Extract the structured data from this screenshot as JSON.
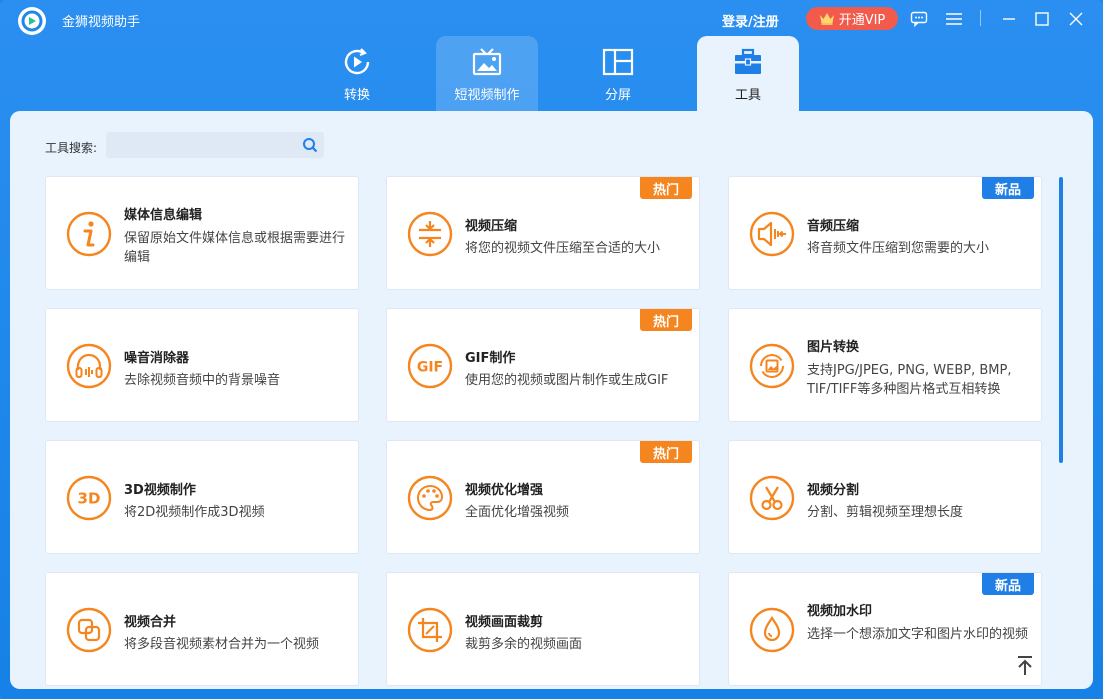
{
  "app": {
    "title": "金狮视频助手",
    "login_label": "登录/注册",
    "vip_label": "开通VIP"
  },
  "tabs": [
    {
      "label": "转换",
      "icon": "play-convert-icon"
    },
    {
      "label": "短视频制作",
      "icon": "tv-image-icon"
    },
    {
      "label": "分屏",
      "icon": "split-screen-icon"
    },
    {
      "label": "工具",
      "icon": "toolbox-icon"
    }
  ],
  "search": {
    "label": "工具搜索:",
    "value": ""
  },
  "cards": [
    {
      "title": "媒体信息编辑",
      "desc": "保留原始文件媒体信息或根据需要进行编辑",
      "icon": "info-icon",
      "badge": ""
    },
    {
      "title": "视频压缩",
      "desc": "将您的视频文件压缩至合适的大小",
      "icon": "compress-icon",
      "badge": "热门"
    },
    {
      "title": "音频压缩",
      "desc": "将音频文件压缩到您需要的大小",
      "icon": "audio-compress-icon",
      "badge": "新品"
    },
    {
      "title": "噪音消除器",
      "desc": "去除视频音频中的背景噪音",
      "icon": "headphones-icon",
      "badge": ""
    },
    {
      "title": "GIF制作",
      "desc": "使用您的视频或图片制作或生成GIF",
      "icon": "gif-icon",
      "badge": "热门"
    },
    {
      "title": "图片转换",
      "desc": "支持JPG/JPEG, PNG, WEBP, BMP, TIF/TIFF等多种图片格式互相转换",
      "icon": "image-convert-icon",
      "badge": ""
    },
    {
      "title": "3D视频制作",
      "desc": "将2D视频制作成3D视频",
      "icon": "3d-icon",
      "badge": ""
    },
    {
      "title": "视频优化增强",
      "desc": "全面优化增强视频",
      "icon": "palette-icon",
      "badge": "热门"
    },
    {
      "title": "视频分割",
      "desc": "分割、剪辑视频至理想长度",
      "icon": "scissors-icon",
      "badge": ""
    },
    {
      "title": "视频合并",
      "desc": "将多段音视频素材合并为一个视频",
      "icon": "merge-icon",
      "badge": ""
    },
    {
      "title": "视频画面裁剪",
      "desc": "裁剪多余的视频画面",
      "icon": "crop-icon",
      "badge": ""
    },
    {
      "title": "视频加水印",
      "desc": "选择一个想添加文字和图片水印的视频",
      "icon": "watermark-icon",
      "badge": "新品"
    }
  ],
  "colors": {
    "accent": "#1f87ea",
    "orange": "#f5851f",
    "hot_badge": "#f5851f",
    "new_badge": "#1f7fe6"
  }
}
